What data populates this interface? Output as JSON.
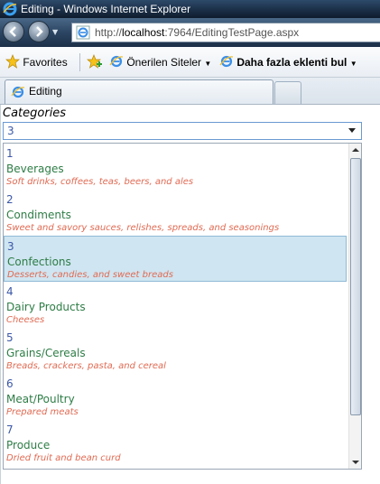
{
  "window": {
    "title": "Editing - Windows Internet Explorer"
  },
  "address_bar": {
    "url_prefix": "http://",
    "url_host": "localhost",
    "url_rest": ":7964/EditingTestPage.aspx"
  },
  "favorites_bar": {
    "favorites_label": "Favorites",
    "suggested_sites_label": "Önerilen Siteler",
    "more_addons_label": "Daha fazla eklenti bul"
  },
  "tabs": [
    {
      "label": "Editing"
    }
  ],
  "page": {
    "field_label": "Categories",
    "selected_value": "3",
    "items": [
      {
        "id": "1",
        "name": "Beverages",
        "description": "Soft drinks, coffees, teas, beers, and ales"
      },
      {
        "id": "2",
        "name": "Condiments",
        "description": "Sweet and savory sauces, relishes, spreads, and seasonings"
      },
      {
        "id": "3",
        "name": "Confections",
        "description": "Desserts, candies, and sweet breads"
      },
      {
        "id": "4",
        "name": "Dairy Products",
        "description": "Cheeses"
      },
      {
        "id": "5",
        "name": "Grains/Cereals",
        "description": "Breads, crackers, pasta, and cereal"
      },
      {
        "id": "6",
        "name": "Meat/Poultry",
        "description": "Prepared meats"
      },
      {
        "id": "7",
        "name": "Produce",
        "description": "Dried fruit and bean curd"
      }
    ]
  },
  "colors": {
    "id_text": "#3b58a8",
    "name_text": "#2e7d46",
    "description_text": "#e06a52",
    "selected_row": "#cfe5f1"
  }
}
